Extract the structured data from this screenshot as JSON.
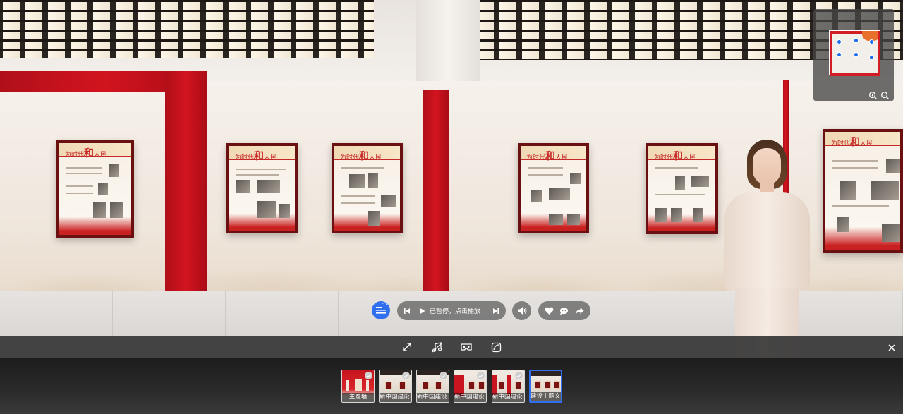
{
  "player": {
    "status_text": "已暂停，点击播放"
  },
  "list_button": {
    "badge": "FLR"
  },
  "thumbnails": [
    {
      "label": "主题墙",
      "active": false,
      "checked": true
    },
    {
      "label": "新中国建设...",
      "active": false,
      "checked": true
    },
    {
      "label": "新中国建设...",
      "active": false,
      "checked": true
    },
    {
      "label": "新中国建设...",
      "active": false,
      "checked": true
    },
    {
      "label": "新中国建设...",
      "active": false,
      "checked": true
    },
    {
      "label": "建设主题文字",
      "active": true,
      "checked": false
    }
  ],
  "posters": {
    "title_prefix": "为时代",
    "title_big": "和",
    "title_suffix": "人民"
  },
  "colors": {
    "accent": "#2f6ff0",
    "brand_red": "#d2141f",
    "toolbar": "#383838"
  },
  "icons": {
    "list": "list-icon",
    "prev": "skip-previous-icon",
    "play": "play-icon",
    "next": "skip-next-icon",
    "volume": "volume-icon",
    "like": "heart-icon",
    "comment": "comment-icon",
    "share": "share-icon",
    "fullscreen": "fullscreen-icon",
    "music": "music-icon",
    "vr": "vr-glasses-icon",
    "gyro": "gyroscope-icon",
    "close": "close-icon",
    "zoom_in": "zoom-in-icon",
    "zoom_out": "zoom-out-icon"
  }
}
